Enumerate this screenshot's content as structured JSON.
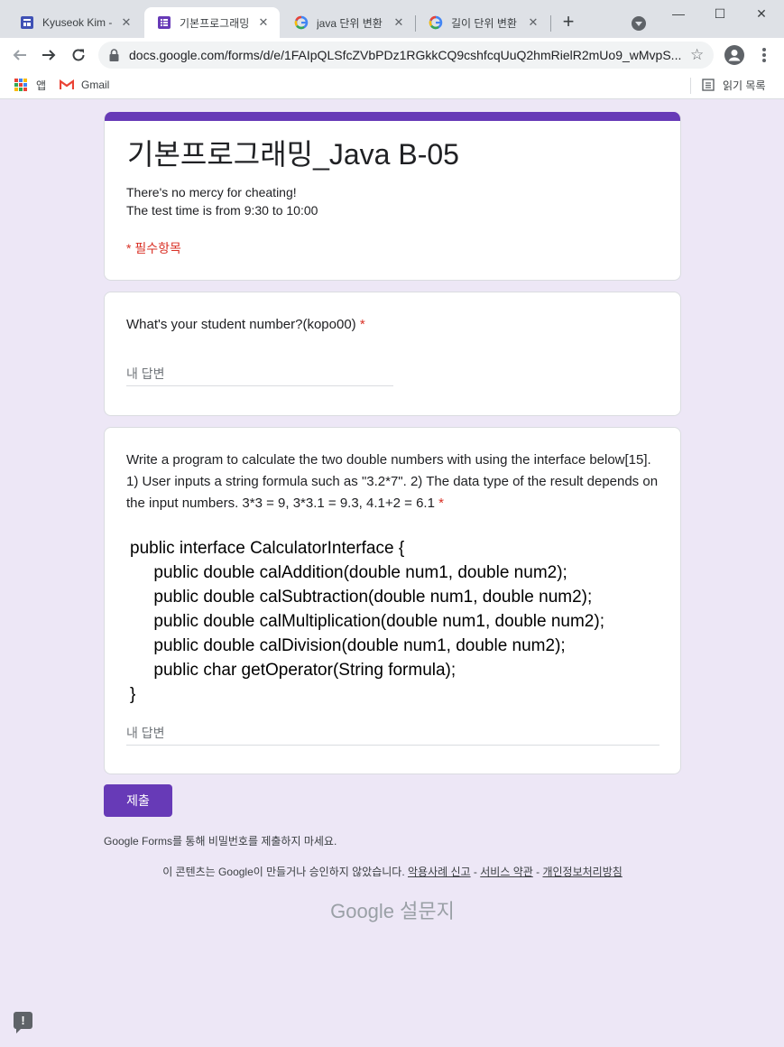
{
  "browser": {
    "tabs": [
      {
        "title": "Kyuseok Kim - J",
        "icon": "forms-layout-icon",
        "icon_color": "#3f51b5"
      },
      {
        "title": "기본프로그래밍",
        "icon": "google-forms-icon",
        "icon_color": "#673ab7"
      },
      {
        "title": "java 단위 변환 ",
        "icon": "google-g-icon"
      },
      {
        "title": "길이 단위 변환",
        "icon": "google-g-icon"
      }
    ],
    "window_controls": {
      "minimize": "—",
      "maximize": "☐",
      "close": "✕"
    },
    "url": "docs.google.com/forms/d/e/1FAIpQLSfcZVbPDz1RGkkCQ9cshfcqUuQ2hmRielR2mUo9_wMvpS...",
    "bookmarks": {
      "apps": "앱",
      "gmail": "Gmail",
      "reading_list": "읽기 목록"
    }
  },
  "form": {
    "accent_color": "#673ab7",
    "title": "기본프로그래밍_Java B-05",
    "description": [
      "There's no mercy for cheating!",
      "The test time is from 9:30 to 10:00"
    ],
    "required_note": "* 필수항목",
    "questions": [
      {
        "title": "What's your student number?(kopo00)",
        "required_mark": "*",
        "answer_placeholder": "내 답변"
      },
      {
        "title": "Write a program to calculate the two double numbers with using the interface below[15]. 1) User inputs a string formula such as \"3.2*7\". 2) The data type of the result depends on the input numbers. 3*3 = 9, 3*3.1 = 9.3, 4.1+2 = 6.1",
        "required_mark": "*",
        "code": "public interface CalculatorInterface {\n     public double calAddition(double num1, double num2);\n     public double calSubtraction(double num1, double num2);\n     public double calMultiplication(double num1, double num2);\n     public double calDivision(double num1, double num2);\n     public char getOperator(String formula);\n}",
        "answer_placeholder": "내 답변"
      }
    ],
    "submit_label": "제출",
    "footer_note": "Google Forms를 통해 비밀번호를 제출하지 마세요.",
    "footer_disclaimer": "이 콘텐츠는 Google이 만들거나 승인하지 않았습니다.",
    "footer_links": [
      "악용사례 신고",
      "서비스 약관",
      "개인정보처리방침"
    ],
    "brand": {
      "google": "Google",
      "product": "설문지"
    }
  }
}
